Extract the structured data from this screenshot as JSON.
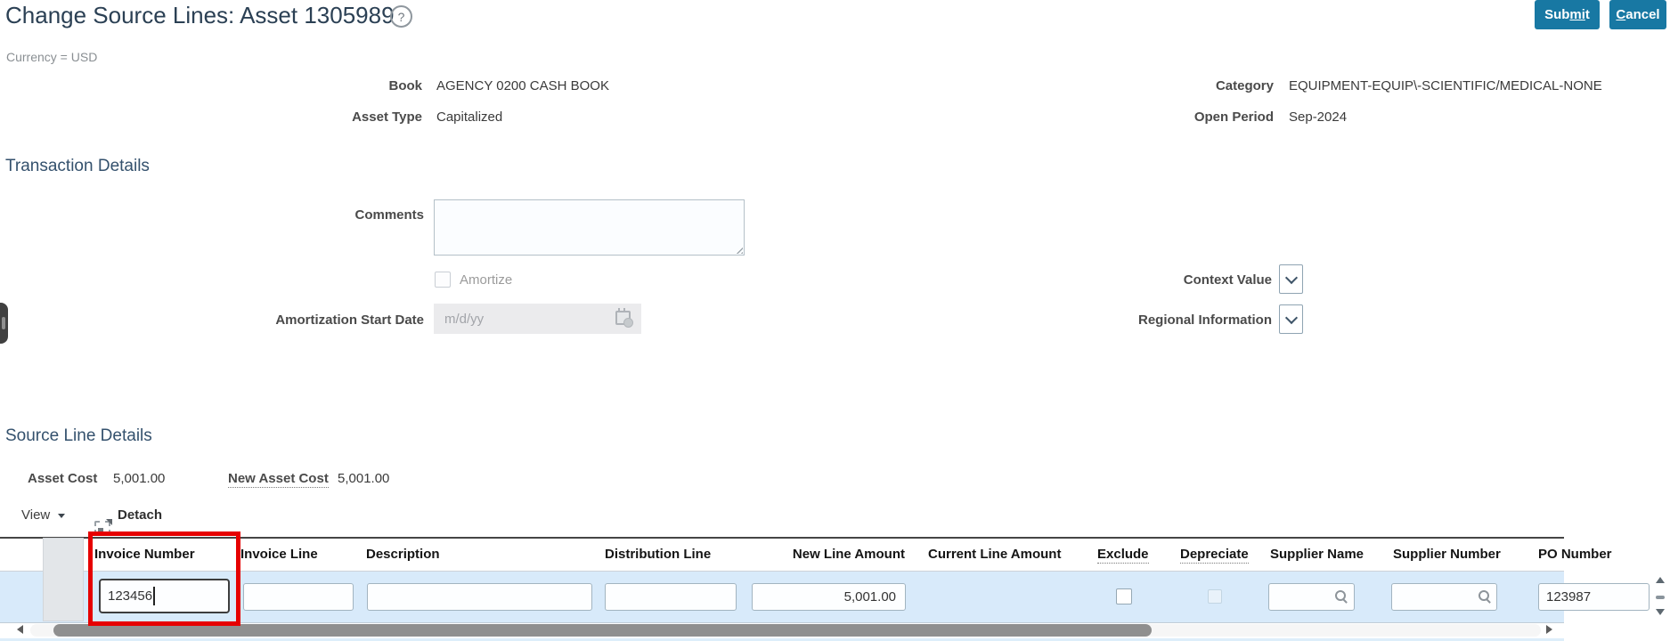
{
  "page": {
    "title": "Change Source Lines: Asset 1305989",
    "help_glyph": "?",
    "currency_note": "Currency = USD"
  },
  "buttons": {
    "submit": {
      "pre": "Sub",
      "accel": "mi",
      "post": "t"
    },
    "cancel": {
      "pre": "",
      "accel": "C",
      "post": "ancel"
    }
  },
  "asset_header": {
    "book_label": "Book",
    "book_value": "AGENCY 0200 CASH BOOK",
    "asset_type_label": "Asset Type",
    "asset_type_value": "Capitalized",
    "category_label": "Category",
    "category_value": "EQUIPMENT-EQUIP\\-SCIENTIFIC/MEDICAL-NONE",
    "open_period_label": "Open Period",
    "open_period_value": "Sep-2024"
  },
  "transaction_details": {
    "heading": "Transaction Details",
    "comments_label": "Comments",
    "comments_value": "",
    "amortize_label": "Amortize",
    "amortization_start_date_label": "Amortization Start Date",
    "amortization_start_date_placeholder": "m/d/yy",
    "context_value_label": "Context Value",
    "regional_information_label": "Regional Information"
  },
  "source_line_details": {
    "heading": "Source Line Details",
    "asset_cost_label": "Asset Cost",
    "asset_cost_value": "5,001.00",
    "new_asset_cost_label": "New Asset Cost",
    "new_asset_cost_value": "5,001.00"
  },
  "toolbar": {
    "view_label": "View",
    "detach_label": "Detach"
  },
  "table": {
    "columns": [
      "Invoice Number",
      "Invoice Line",
      "Description",
      "Distribution Line",
      "New Line Amount",
      "Current Line Amount",
      "Exclude",
      "Depreciate",
      "Supplier Name",
      "Supplier Number",
      "PO Number"
    ],
    "row": {
      "invoice_number": "123456",
      "invoice_line": "",
      "description": "",
      "distribution_line": "",
      "new_line_amount": "5,001.00",
      "current_line_amount": "",
      "exclude_checked": false,
      "depreciate_checked": false,
      "supplier_name": "",
      "supplier_number": "",
      "po_number": "123987"
    }
  },
  "icons": {
    "help": "question-circle",
    "view_menu": "triangle-down",
    "detach": "detach-window",
    "calendar": "calendar-clock",
    "search": "magnifier",
    "dropdown": "chevron-down",
    "row_expand": "triangle-right",
    "scrollbars": [
      "up",
      "down",
      "left",
      "right"
    ]
  },
  "colors": {
    "button_bg": "#1878a3",
    "highlight_border": "#e60000",
    "row_bg": "#d8eafa",
    "heading": "#34516d"
  }
}
